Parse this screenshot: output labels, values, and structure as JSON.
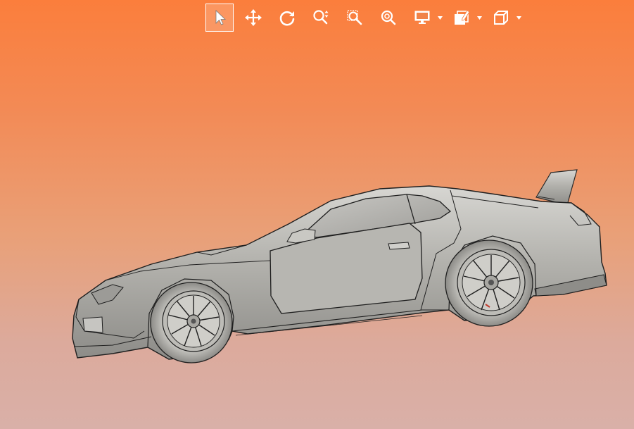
{
  "app": {
    "view": "3d-model-viewport",
    "background_top": "#fb7e3c",
    "background_bottom": "#d9b0a8"
  },
  "toolbar": {
    "icon_color": "#ffffff",
    "active_tool": "select",
    "tools": [
      {
        "id": "select",
        "icon": "cursor-arrow-icon",
        "active": true
      },
      {
        "id": "pan",
        "icon": "move-arrows-icon"
      },
      {
        "id": "rotate",
        "icon": "rotate-icon"
      },
      {
        "id": "zoom",
        "icon": "zoom-updown-icon"
      },
      {
        "id": "zoom-window",
        "icon": "zoom-window-icon"
      },
      {
        "id": "zoom-fit",
        "icon": "zoom-fit-icon"
      },
      {
        "id": "display-mode",
        "icon": "monitor-icon",
        "dropdown": true
      },
      {
        "id": "view-styles",
        "icon": "layers-edit-icon",
        "dropdown": true
      },
      {
        "id": "standard-views",
        "icon": "cube-icon",
        "dropdown": true
      }
    ]
  },
  "model": {
    "subject": "sports-car-3d-model",
    "body_color": "#a9a8a3"
  }
}
